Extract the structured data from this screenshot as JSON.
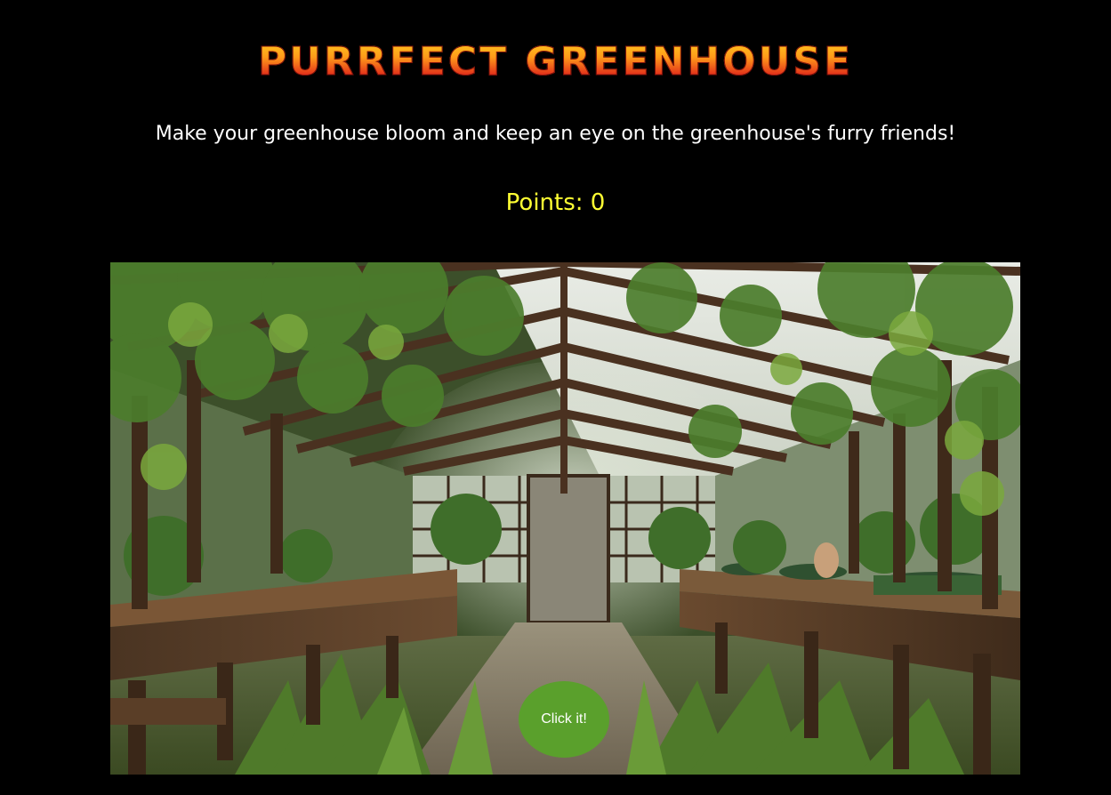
{
  "game": {
    "title": "Purrfect Greenhouse",
    "subtitle": "Make your greenhouse bloom and keep an eye on the greenhouse's furry friends!",
    "points_text": "Points: 0",
    "points": 0,
    "click_button_label": "Click it!"
  },
  "colors": {
    "background": "#000000",
    "title_gradient": [
      "#ffd21f",
      "#e2301a"
    ],
    "points_text": "#ffff33",
    "button": "#5aa02c"
  }
}
